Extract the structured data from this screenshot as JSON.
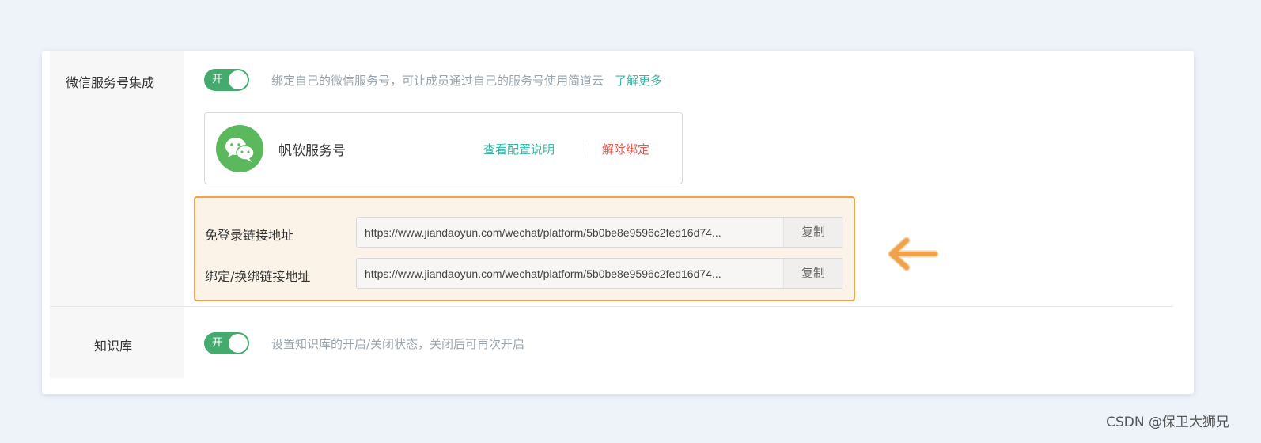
{
  "settings": {
    "wechat": {
      "label": "微信服务号集成",
      "toggle_text": "开",
      "description": "绑定自己的微信服务号，可让成员通过自己的服务号使用简道云",
      "learn_more": "了解更多",
      "account": {
        "name": "帆软服务号",
        "view_config": "查看配置说明",
        "unbind": "解除绑定"
      },
      "links": [
        {
          "label": "免登录链接地址",
          "value": "https://www.jiandaoyun.com/wechat/platform/5b0be8e9596c2fed16d74...",
          "copy": "复制"
        },
        {
          "label": "绑定/换绑链接地址",
          "value": "https://www.jiandaoyun.com/wechat/platform/5b0be8e9596c2fed16d74...",
          "copy": "复制"
        }
      ]
    },
    "knowledge_base": {
      "label": "知识库",
      "toggle_text": "开",
      "description": "设置知识库的开启/关闭状态，关闭后可再次开启"
    }
  },
  "annotation": {
    "arrow_icon": "arrow-left-icon",
    "color": "#f0a24a"
  },
  "watermark": "CSDN @保卫大狮兄",
  "colors": {
    "accent_green": "#44aa6e",
    "link_teal": "#3cb4a3",
    "danger_red": "#e5574d",
    "highlight_orange": "#f0a24a"
  }
}
